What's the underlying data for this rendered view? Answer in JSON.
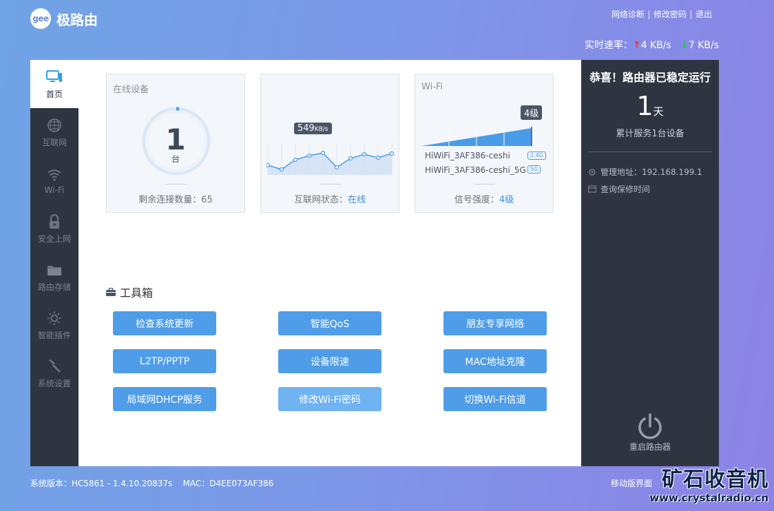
{
  "header": {
    "logo_badge": "gee",
    "logo_text": "极路由",
    "links": [
      "网络诊断",
      "修改密码",
      "退出"
    ],
    "speed_label": "实时速率：",
    "upload": "4 KB/s",
    "download": "7 KB/s"
  },
  "sidebar": {
    "items": [
      {
        "label": "首页",
        "icon": "monitor-icon",
        "active": true
      },
      {
        "label": "互联网",
        "icon": "globe-icon"
      },
      {
        "label": "Wi-Fi",
        "icon": "wifi-icon"
      },
      {
        "label": "安全上网",
        "icon": "lock-icon"
      },
      {
        "label": "路由存储",
        "icon": "folder-icon"
      },
      {
        "label": "智能插件",
        "icon": "sun-icon"
      },
      {
        "label": "系统设置",
        "icon": "wrench-icon"
      }
    ]
  },
  "cards": {
    "devices": {
      "title": "在线设备",
      "count": "1",
      "unit": "台",
      "footer_label": "剩余连接数量：",
      "footer_value": "65"
    },
    "internet": {
      "speed_value": "549",
      "speed_unit": "KB/s",
      "footer_label": "互联网状态：",
      "footer_value": "在线",
      "sparkline": [
        52,
        58,
        44,
        38,
        34,
        55,
        42,
        36,
        41,
        35
      ]
    },
    "wifi": {
      "title": "Wi-Fi",
      "level": "4级",
      "ssid1": "HiWiFi_3AF386-ceshi",
      "band1": "2.4G",
      "ssid2": "HiWiFi_3AF386-ceshi_5G",
      "band2": "5G",
      "footer_label": "信号强度：",
      "footer_value": "4级"
    }
  },
  "toolbox": {
    "title": "工具箱",
    "buttons": [
      "检查系统更新",
      "智能QoS",
      "朋友专享网络",
      "L2TP/PPTP",
      "设备限速",
      "MAC地址克隆",
      "局域网DHCP服务",
      "修改Wi-Fi密码",
      "切换Wi-Fi信道"
    ]
  },
  "right_panel": {
    "title": "恭喜！路由器已稳定运行",
    "days": "1",
    "days_unit": "天",
    "serve_text": "累计服务1台设备",
    "admin_label": "管理地址：192.168.199.1",
    "warranty_label": "查询保修时间",
    "reboot_label": "重启路由器"
  },
  "footer": {
    "version": "系统版本：HC5861 - 1.4.10.20837s",
    "mac": "MAC：D4EE073AF386",
    "mobile": "移动版界面"
  },
  "watermark": {
    "cn": "矿石收音机",
    "url": "www.crystalradio.cn"
  },
  "colors": {
    "accent": "#4f9de8",
    "dark": "#2f3441",
    "up": "#e03a3a",
    "down": "#2dbd5a"
  }
}
